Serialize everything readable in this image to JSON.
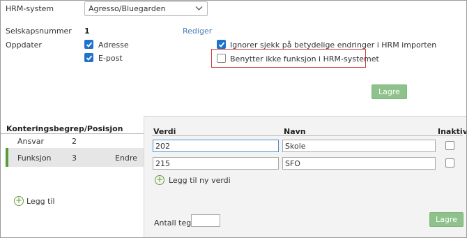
{
  "settings": {
    "hrm_label": "HRM-system",
    "hrm_value": "Agresso/Bluegarden",
    "company_label": "Selskapsnummer",
    "company_value": "1",
    "edit_link": "Rediger",
    "update_label": "Oppdater",
    "opt_address": "Adresse",
    "opt_email": "E-post",
    "opt_ignore": "Ignorer sjekk på betydelige endringer i HRM importen",
    "opt_no_function": "Benytter ikke funksjon i HRM-systemet",
    "save": "Lagre"
  },
  "left": {
    "title": "Konteringsbegrep/Posisjon",
    "rows": [
      {
        "name": "Ansvar",
        "pos": "2",
        "action": ""
      },
      {
        "name": "Funksjon",
        "pos": "3",
        "action": "Endre"
      }
    ],
    "add": "Legg til"
  },
  "right": {
    "col_value": "Verdi",
    "col_name": "Navn",
    "col_inactive": "Inaktiv",
    "rows": [
      {
        "value": "202",
        "name": "Skole"
      },
      {
        "value": "215",
        "name": "SFO"
      }
    ],
    "add_value": "Legg til ny verdi",
    "char_count_label": "Antall tegn",
    "char_count_value": "",
    "save": "Lagre"
  },
  "colors": {
    "accent": "#1f73cc",
    "save_green": "#8fc28b",
    "highlight": "#d43b3b",
    "selected_bar": "#5b9a3b"
  }
}
